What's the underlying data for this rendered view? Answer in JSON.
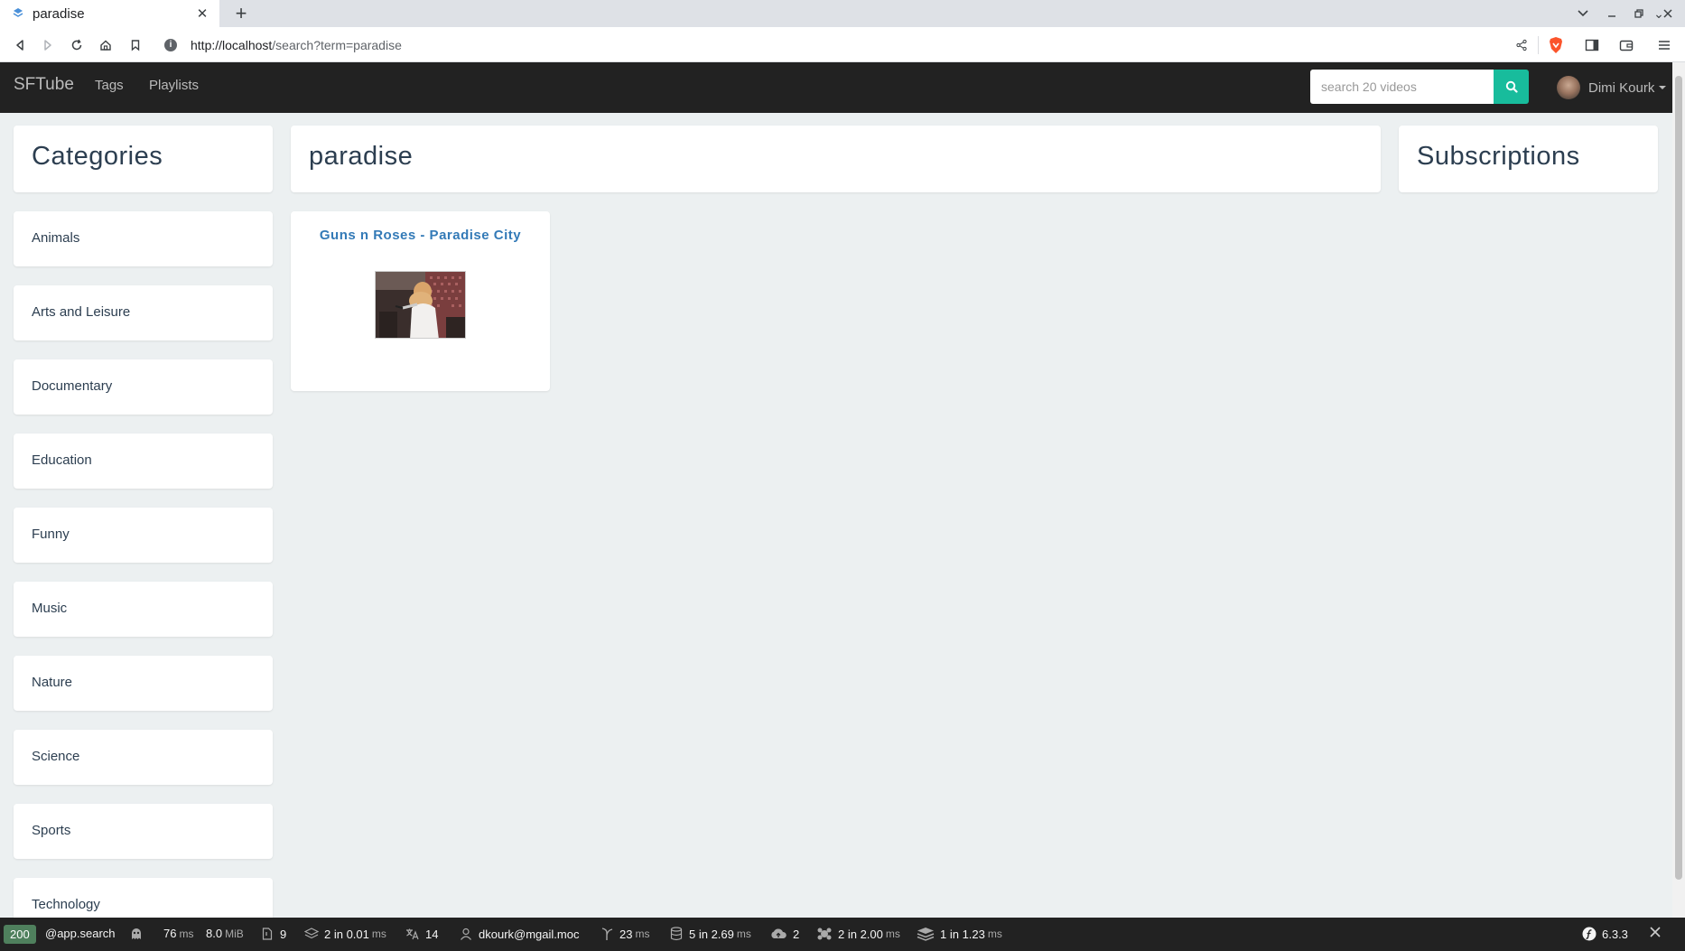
{
  "browser": {
    "tab_title": "paradise",
    "url_host": "http://localhost",
    "url_path": "/search?term=paradise",
    "new_tab_label": "+",
    "tab_close_label": "✕"
  },
  "navbar": {
    "brand": "SFTube",
    "links": [
      "Tags",
      "Playlists"
    ],
    "search_placeholder": "search 20 videos",
    "user_name": "Dimi Kourk",
    "accent_color": "#18bc9c"
  },
  "sidebar": {
    "heading": "Categories",
    "categories": [
      "Animals",
      "Arts and Leisure",
      "Documentary",
      "Education",
      "Funny",
      "Music",
      "Nature",
      "Science",
      "Sports",
      "Technology"
    ]
  },
  "main": {
    "heading": "paradise",
    "videos": [
      {
        "title": "Guns n Roses - Paradise City"
      }
    ]
  },
  "subscriptions": {
    "heading": "Subscriptions"
  },
  "debug_toolbar": {
    "status": "200",
    "route": "@app.search",
    "time_value": "76",
    "time_unit": "ms",
    "memory_value": "8.0",
    "memory_unit": "MiB",
    "logs": "9",
    "cache_value": "2 in 0.01",
    "cache_unit": "ms",
    "translations": "14",
    "user": "dkourk@mgail.moc",
    "twig_value": "23",
    "twig_unit": "ms",
    "doctrine_value": "5 in 2.69",
    "doctrine_unit": "ms",
    "http_client": "2",
    "events_value": "2 in 2.00",
    "events_unit": "ms",
    "messenger_value": "1 in 1.23",
    "messenger_unit": "ms",
    "version": "6.3.3"
  }
}
